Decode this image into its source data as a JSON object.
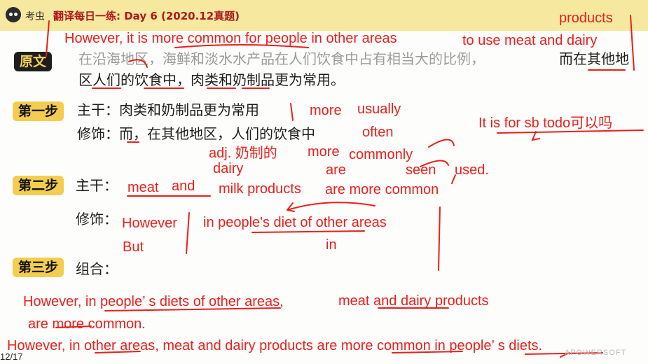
{
  "header": {
    "brand": "考虫",
    "lesson_title": "翻译每日一练: Day 6 (2020.12真题)"
  },
  "original": {
    "tag": "原文",
    "line1_gray": "在沿海地区，海鲜和淡水水产品在人们饮食中占有相当大的比例，",
    "line1_black": "而在其他地",
    "line2": "区人们的饮食中，肉类和奶制品更为常用。"
  },
  "step1": {
    "tag": "第一步",
    "main_text": "主干：肉类和奶制品更为常用",
    "modifier_text": "修饰：而，在其他地区，人们的饮食中"
  },
  "step2": {
    "tag": "第二步",
    "main_label": "主干：",
    "modifier_label": "修饰："
  },
  "step3": {
    "tag": "第三步",
    "label": "组合："
  },
  "annotations": {
    "top_sentence_a": "However, it is more common for people in other areas",
    "top_sentence_b": "to use meat and dairy",
    "products_top": "products",
    "it_is_question": "It is for sb todo可以吗",
    "more": "more",
    "usually": "usually",
    "often": "often",
    "adj_dairy": "adj. 奶制的",
    "more2": "more",
    "commonly": "commonly",
    "dairy": "dairy",
    "are": "are",
    "seen": "seen",
    "used": "used.",
    "meat": "meat",
    "and": "and",
    "milk_products": "milk products",
    "are_more_common": "are more common",
    "however": "However",
    "but": "But",
    "in_peoples_diet": "in people's diet of other areas",
    "in": "in",
    "combined_1a": "However,  in people’  s diets of other areas,",
    "combined_1b": "meat and dairy products",
    "combined_2": "are more common.",
    "final_sentence": "However, in other areas, meat and dairy products are more common in people’  s diets."
  },
  "footer": {
    "page_number": "12/17",
    "watermark": "APOWERSOFT"
  },
  "colors": {
    "ink_red": "#e8201d",
    "header_bg": "#f7e8a0",
    "tag_yellow": "#f3cd4f",
    "tag_dark": "#1e1e1e",
    "title_red": "#b0171c"
  }
}
